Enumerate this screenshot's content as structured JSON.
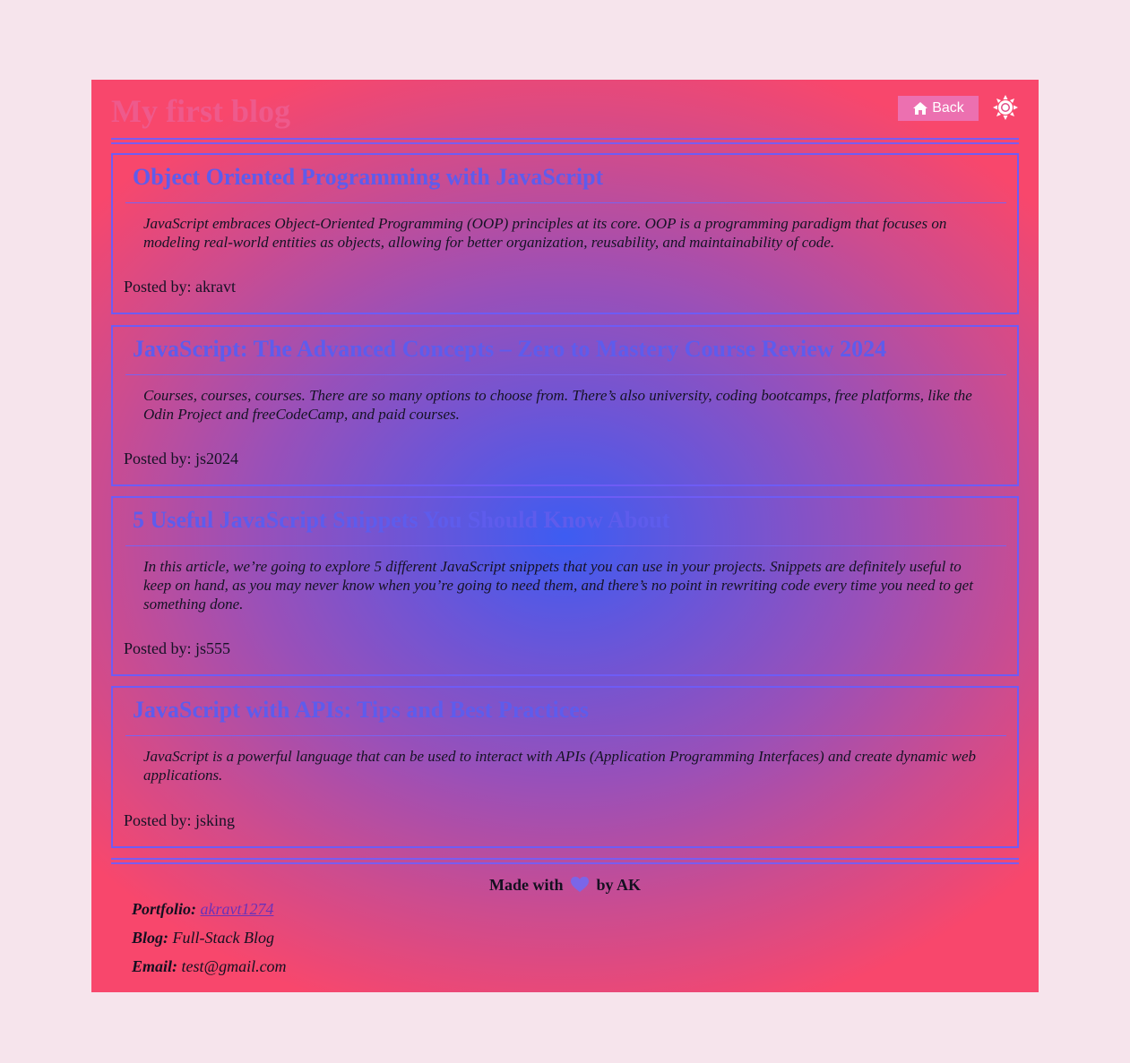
{
  "header": {
    "site_title": "My first blog",
    "back_label": "Back",
    "back_icon": "home-icon",
    "theme_icon": "sun-icon"
  },
  "posts": [
    {
      "title": "Object Oriented Programming with JavaScript",
      "body": "JavaScript embraces Object-Oriented Programming (OOP) principles at its core. OOP is a programming paradigm that focuses on modeling real-world entities as objects, allowing for better organization, reusability, and maintainability of code.",
      "author": "Posted by: akravt"
    },
    {
      "title": "JavaScript: The Advanced Concepts – Zero to Mastery Course Review 2024",
      "body": "Courses, courses, courses. There are so many options to choose from. There’s also university, coding bootcamps, free platforms, like the Odin Project and freeCodeCamp, and paid courses.",
      "author": "Posted by: js2024"
    },
    {
      "title": "5 Useful JavaScript Snippets You Should Know About",
      "body": "In this article, we’re going to explore 5 different JavaScript snippets that you can use in your projects. Snippets are definitely useful to keep on hand, as you may never know when you’re going to need them, and there’s no point in rewriting code every time you need to get something done.",
      "author": "Posted by: js555"
    },
    {
      "title": "JavaScript with APIs: Tips and Best Practices",
      "body": "JavaScript is a powerful language that can be used to interact with APIs (Application Programming Interfaces) and create dynamic web applications.",
      "author": "Posted by: jsking"
    }
  ],
  "footer": {
    "made_prefix": "Made with",
    "made_suffix": "by AK",
    "heart_icon": "heart-icon",
    "portfolio_label": "Portfolio:",
    "portfolio_link": "akravt1274",
    "blog_label": "Blog:",
    "blog_value": "Full-Stack Blog",
    "email_label": "Email:",
    "email_value": "test@gmail.com"
  },
  "colors": {
    "page_background": "#f6e4ec",
    "gradient_center": "#3d5cf2",
    "gradient_edge": "#f8476c",
    "title_pink": "#ee5a8c",
    "post_title_blue": "#5e5cec",
    "border_purple": "#6e5cf5",
    "back_button": "#ec70b0"
  }
}
